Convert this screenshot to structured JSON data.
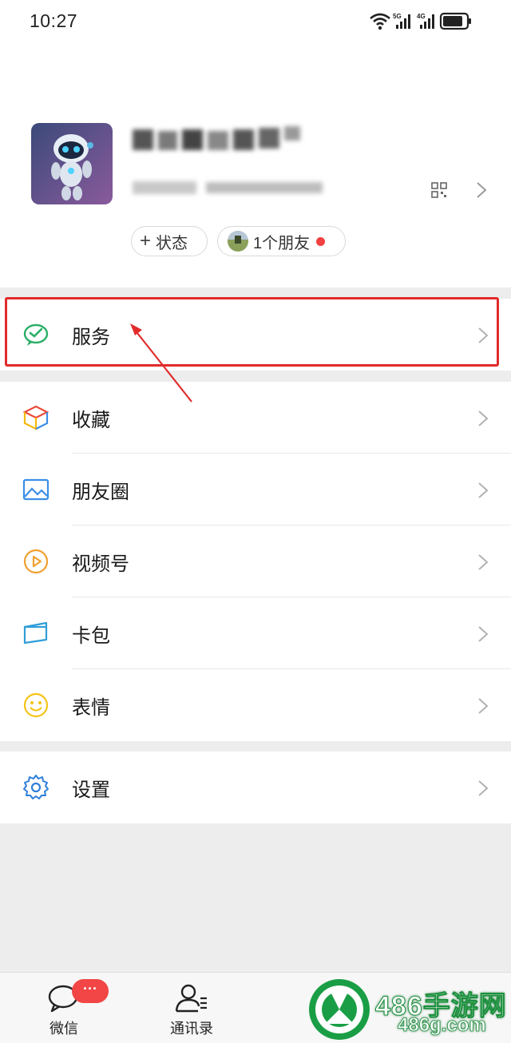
{
  "status_bar": {
    "time": "10:27",
    "network_labels": [
      "5G",
      "4G"
    ]
  },
  "profile": {
    "chips": {
      "status_label": "状态",
      "friends_label": "1个朋友"
    }
  },
  "menu": {
    "highlighted": [
      {
        "label": "服务",
        "icon": "wechat-pay-icon",
        "color": "#2aae67"
      }
    ],
    "group1": [
      {
        "label": "收藏",
        "icon": "favorites-cube-icon"
      },
      {
        "label": "朋友圈",
        "icon": "moments-image-icon"
      },
      {
        "label": "视频号",
        "icon": "channels-play-icon"
      },
      {
        "label": "卡包",
        "icon": "card-wallet-icon"
      },
      {
        "label": "表情",
        "icon": "sticker-smile-icon"
      }
    ],
    "group2": [
      {
        "label": "设置",
        "icon": "gear-icon"
      }
    ]
  },
  "tab_bar": {
    "tabs": [
      {
        "label": "微信",
        "icon": "chat-bubble-icon"
      },
      {
        "label": "通讯录",
        "icon": "contacts-icon"
      }
    ],
    "badge": "···"
  },
  "watermark": {
    "title": "486手游网",
    "url": "486g.com"
  },
  "colors": {
    "highlight": "#e12b2b",
    "badge": "#f24545",
    "watermark_green": "#1a8f3c"
  }
}
